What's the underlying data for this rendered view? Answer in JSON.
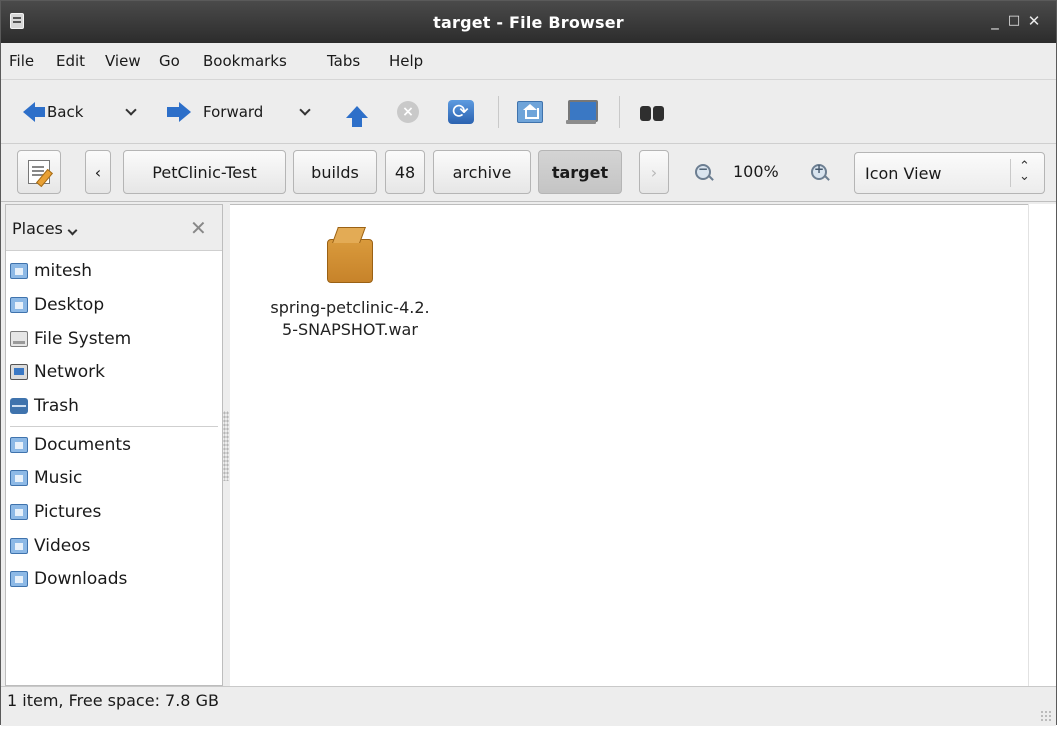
{
  "window": {
    "title": "target - File Browser"
  },
  "menubar": [
    "File",
    "Edit",
    "View",
    "Go",
    "Bookmarks",
    "Tabs",
    "Help"
  ],
  "toolbar": {
    "back_label": "Back",
    "forward_label": "Forward"
  },
  "location": {
    "crumbs": [
      "PetClinic-Test",
      "builds",
      "48",
      "archive",
      "target"
    ],
    "active_crumb": "target",
    "zoom_level": "100%",
    "view_mode": "Icon View"
  },
  "sidebar": {
    "header": "Places",
    "places": [
      "mitesh",
      "Desktop",
      "File System",
      "Network",
      "Trash"
    ],
    "bookmarks": [
      "Documents",
      "Music",
      "Pictures",
      "Videos",
      "Downloads"
    ]
  },
  "files": [
    {
      "name_line1": "spring-petclinic-4.2.",
      "name_line2": "5-SNAPSHOT.war",
      "icon": "package-icon"
    }
  ],
  "status": {
    "text": "1 item, Free space: 7.8 GB"
  },
  "colors": {
    "accent": "#2d6fc9",
    "titlebar": "#2c2c2c",
    "package": "#d99a3c"
  }
}
